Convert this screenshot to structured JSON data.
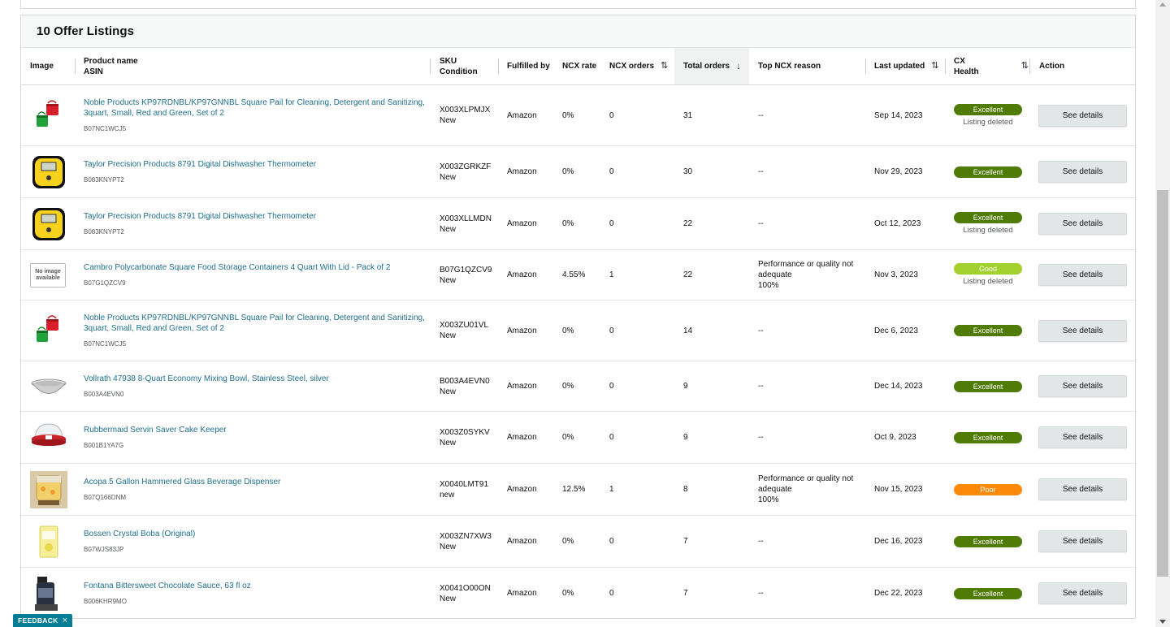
{
  "section": {
    "title": "10 Offer Listings"
  },
  "columns": {
    "image": "Image",
    "product_name": "Product name",
    "asin": "ASIN",
    "sku": "SKU",
    "condition": "Condition",
    "fulfilled_by": "Fulfilled by",
    "ncx_rate": "NCX rate",
    "ncx_orders": "NCX orders",
    "total_orders": "Total orders",
    "top_ncx_reason": "Top NCX reason",
    "last_updated": "Last updated",
    "cx_health": "CX Health",
    "action": "Action"
  },
  "health_colors": {
    "Excellent": "#507b07",
    "Good": "#a2d02c",
    "Poor": "#fe8a0a"
  },
  "rows": [
    {
      "thumb": "pails",
      "name": "Noble Products KP97RDNBL/KP97GNNBL Square Pail for Cleaning, Detergent and Sanitizing, 3quart, Small, Red and Green, Set of 2",
      "asin": "B07NC1WCJ5",
      "sku": "X003XLPMJX",
      "condition": "New",
      "fulfilled": "Amazon",
      "ncx_rate": "0%",
      "ncx_orders": "0",
      "total_orders": "31",
      "reason_1": "--",
      "reason_2": "",
      "reason_3": "",
      "updated": "Sep 14, 2023",
      "health": "Excellent",
      "health_sub": "Listing deleted",
      "action": "See details"
    },
    {
      "thumb": "thermo",
      "name": "Taylor Precision Products 8791 Digital Dishwasher Thermometer",
      "asin": "B083KNYPT2",
      "sku": "X003ZGRKZF",
      "condition": "New",
      "fulfilled": "Amazon",
      "ncx_rate": "0%",
      "ncx_orders": "0",
      "total_orders": "30",
      "reason_1": "--",
      "reason_2": "",
      "reason_3": "",
      "updated": "Nov 29, 2023",
      "health": "Excellent",
      "health_sub": "",
      "action": "See details"
    },
    {
      "thumb": "thermo",
      "name": "Taylor Precision Products 8791 Digital Dishwasher Thermometer",
      "asin": "B083KNYPT2",
      "sku": "X003XLLMDN",
      "condition": "New",
      "fulfilled": "Amazon",
      "ncx_rate": "0%",
      "ncx_orders": "0",
      "total_orders": "22",
      "reason_1": "--",
      "reason_2": "",
      "reason_3": "",
      "updated": "Oct 12, 2023",
      "health": "Excellent",
      "health_sub": "Listing deleted",
      "action": "See details"
    },
    {
      "thumb": "noimage",
      "noimg_1": "No image",
      "noimg_2": "available",
      "name": "Cambro Polycarbonate Square Food Storage Containers 4 Quart With Lid - Pack of 2",
      "asin": "B07G1QZCV9",
      "sku": "B07G1QZCV9",
      "condition": "New",
      "fulfilled": "Amazon",
      "ncx_rate": "4.55%",
      "ncx_orders": "1",
      "total_orders": "22",
      "reason_1": "Performance or quality not",
      "reason_2": "adequate",
      "reason_3": "100%",
      "updated": "Nov 3, 2023",
      "health": "Good",
      "health_sub": "Listing deleted",
      "action": "See details"
    },
    {
      "thumb": "pails",
      "name": "Noble Products KP97RDNBL/KP97GNNBL Square Pail for Cleaning, Detergent and Sanitizing, 3quart, Small, Red and Green, Set of 2",
      "asin": "B07NC1WCJ5",
      "sku": "X003ZU01VL",
      "condition": "New",
      "fulfilled": "Amazon",
      "ncx_rate": "0%",
      "ncx_orders": "0",
      "total_orders": "14",
      "reason_1": "--",
      "reason_2": "",
      "reason_3": "",
      "updated": "Dec 6, 2023",
      "health": "Excellent",
      "health_sub": "",
      "action": "See details"
    },
    {
      "thumb": "bowl",
      "name": "Vollrath 47938 8-Quart Economy Mixing Bowl, Stainless Steel, silver",
      "asin": "B003A4EVN0",
      "sku": "B003A4EVN0",
      "condition": "New",
      "fulfilled": "Amazon",
      "ncx_rate": "0%",
      "ncx_orders": "0",
      "total_orders": "9",
      "reason_1": "--",
      "reason_2": "",
      "reason_3": "",
      "updated": "Dec 14, 2023",
      "health": "Excellent",
      "health_sub": "",
      "action": "See details"
    },
    {
      "thumb": "cake",
      "name": "Rubbermaid Servin Saver Cake Keeper",
      "asin": "B001B1YA7G",
      "sku": "X003Z0SYKV",
      "condition": "New",
      "fulfilled": "Amazon",
      "ncx_rate": "0%",
      "ncx_orders": "0",
      "total_orders": "9",
      "reason_1": "--",
      "reason_2": "",
      "reason_3": "",
      "updated": "Oct 9, 2023",
      "health": "Excellent",
      "health_sub": "",
      "action": "See details"
    },
    {
      "thumb": "dispenser",
      "name": "Acopa 5 Gallon Hammered Glass Beverage Dispenser",
      "asin": "B07Q166DNM",
      "sku": "X0040LMT91",
      "condition": "new",
      "fulfilled": "Amazon",
      "ncx_rate": "12.5%",
      "ncx_orders": "1",
      "total_orders": "8",
      "reason_1": "Performance or quality not",
      "reason_2": "adequate",
      "reason_3": "100%",
      "updated": "Nov 15, 2023",
      "health": "Poor",
      "health_sub": "",
      "action": "See details"
    },
    {
      "thumb": "boba",
      "name": "Bossen Crystal Boba (Original)",
      "asin": "B07WJS83JP",
      "sku": "X003ZN7XW3",
      "condition": "New",
      "fulfilled": "Amazon",
      "ncx_rate": "0%",
      "ncx_orders": "0",
      "total_orders": "7",
      "reason_1": "--",
      "reason_2": "",
      "reason_3": "",
      "updated": "Dec 16, 2023",
      "health": "Excellent",
      "health_sub": "",
      "action": "See details"
    },
    {
      "thumb": "sauce",
      "name": "Fontana Bittersweet Chocolate Sauce, 63 fl oz",
      "asin": "B006KHR9MO",
      "sku": "X0041O00ON",
      "condition": "New",
      "fulfilled": "Amazon",
      "ncx_rate": "0%",
      "ncx_orders": "0",
      "total_orders": "7",
      "reason_1": "--",
      "reason_2": "",
      "reason_3": "",
      "updated": "Dec 22, 2023",
      "health": "Excellent",
      "health_sub": "",
      "action": "See details"
    }
  ],
  "feedback": {
    "label": "FEEDBACK",
    "close": "×"
  }
}
